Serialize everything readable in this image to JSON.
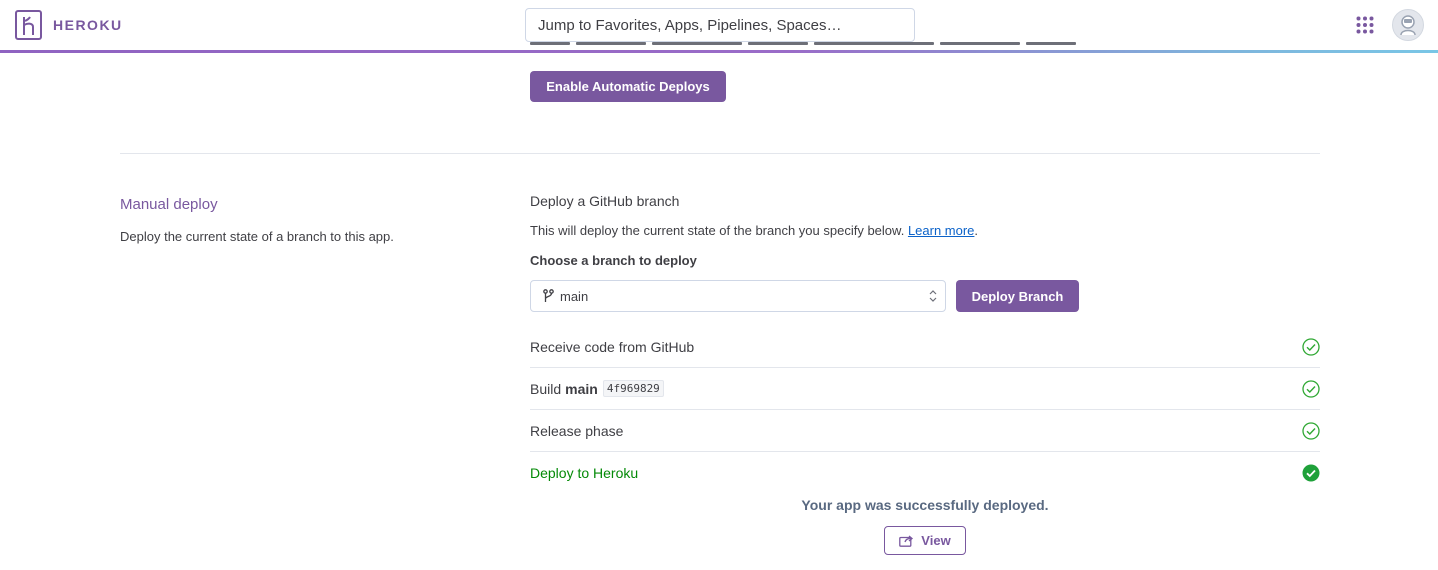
{
  "header": {
    "brand": "HEROKU",
    "search_placeholder": "Jump to Favorites, Apps, Pipelines, Spaces…",
    "apps_icon": "grid-icon",
    "avatar_icon": "user-avatar"
  },
  "automatic_deploys": {
    "enable_button": "Enable Automatic Deploys"
  },
  "manual_deploy": {
    "title": "Manual deploy",
    "description": "Deploy the current state of a branch to this app.",
    "github_title": "Deploy a GitHub branch",
    "github_desc": "This will deploy the current state of the branch you specify below.",
    "learn_more": "Learn more",
    "period": ".",
    "choose_label": "Choose a branch to deploy",
    "branch_value": "main",
    "deploy_button": "Deploy Branch",
    "steps": [
      {
        "label": "Receive code from GitHub",
        "status": "done"
      },
      {
        "label": "Build",
        "branch": "main",
        "sha": "4f969829",
        "status": "done"
      },
      {
        "label": "Release phase",
        "status": "done"
      },
      {
        "label": "Deploy to Heroku",
        "status": "complete"
      }
    ],
    "success_message": "Your app was successfully deployed.",
    "view_button": "View"
  },
  "colors": {
    "brand": "#79589f",
    "success": "#048a07",
    "link": "#0b62c9",
    "check_outline": "#2fa833"
  }
}
